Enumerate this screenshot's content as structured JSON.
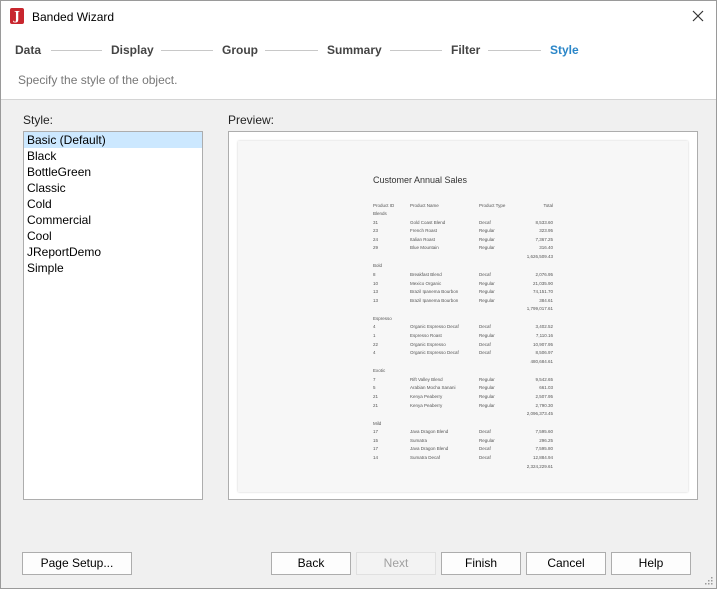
{
  "window": {
    "title": "Banded Wizard"
  },
  "steps": [
    {
      "label": "Data",
      "active": false
    },
    {
      "label": "Display",
      "active": false
    },
    {
      "label": "Group",
      "active": false
    },
    {
      "label": "Summary",
      "active": false
    },
    {
      "label": "Filter",
      "active": false
    },
    {
      "label": "Style",
      "active": true
    }
  ],
  "subtitle": "Specify the style of the object.",
  "style_panel": {
    "label": "Style:",
    "selected": "Basic (Default)",
    "items": [
      "Basic (Default)",
      "Black",
      "BottleGreen",
      "Classic",
      "Cold",
      "Commercial",
      "Cool",
      "JReportDemo",
      "Simple"
    ]
  },
  "preview": {
    "label": "Preview:",
    "report": {
      "title": "Customer Annual Sales",
      "columns": [
        "Product ID",
        "Product Name",
        "Product Type",
        "Total"
      ],
      "groups": [
        {
          "name": "Blends",
          "rows": [
            [
              "31",
              "Gold Coast Blend",
              "Decaf",
              "8,533.60"
            ],
            [
              "23",
              "French Roast",
              "Regular",
              "323.95"
            ],
            [
              "24",
              "Italian Roast",
              "Regular",
              "7,367.25"
            ],
            [
              "29",
              "Blue Mountain",
              "Regular",
              "316.40"
            ]
          ],
          "total": "1,626,509.43"
        },
        {
          "name": "Bold",
          "rows": [
            [
              "8",
              "Breakfast Blend",
              "Decaf",
              "2,076.95"
            ],
            [
              "10",
              "Mexico Organic",
              "Regular",
              "21,035.90"
            ],
            [
              "13",
              "Brazil Ipanema Bourbon",
              "Regular",
              "74,151.70"
            ],
            [
              "13",
              "Brazil Ipanema Bourbon",
              "Regular",
              "384.61"
            ]
          ],
          "total": "1,799,017.61"
        },
        {
          "name": "Espresso",
          "rows": [
            [
              "4",
              "Organic Espresso Decaf",
              "Decaf",
              "3,402.52"
            ],
            [
              "1",
              "Espresso Roast",
              "Regular",
              "7,110.16"
            ],
            [
              "22",
              "Organic Espresso",
              "Decaf",
              "10,907.95"
            ],
            [
              "4",
              "Organic Espresso Decaf",
              "Decaf",
              "8,506.97"
            ]
          ],
          "total": "480,684.61"
        },
        {
          "name": "Exotic",
          "rows": [
            [
              "7",
              "Rift Valley Blend",
              "Regular",
              "9,542.65"
            ],
            [
              "5",
              "Arabian Mocha Sanani",
              "Regular",
              "661.03"
            ],
            [
              "21",
              "Kenya Peaberry",
              "Regular",
              "2,507.95"
            ],
            [
              "21",
              "Kenya Peaberry",
              "Regular",
              "2,790.30"
            ]
          ],
          "total": "2,096,373.45"
        },
        {
          "name": "Mild",
          "rows": [
            [
              "17",
              "Java Dragon Blend",
              "Decaf",
              "7,595.60"
            ],
            [
              "15",
              "Sumatra",
              "Regular",
              "296.25"
            ],
            [
              "17",
              "Java Dragon Blend",
              "Decaf",
              "7,595.80"
            ],
            [
              "14",
              "Sumatra Decaf",
              "Decaf",
              "12,884.94"
            ]
          ],
          "total": "2,324,229.61"
        }
      ]
    }
  },
  "buttons": {
    "page_setup": "Page Setup...",
    "back": "Back",
    "next": "Next",
    "finish": "Finish",
    "cancel": "Cancel",
    "help": "Help"
  },
  "colors": {
    "accent": "#2a86c8",
    "selection": "#cce8ff",
    "brand": "#c8262e"
  }
}
